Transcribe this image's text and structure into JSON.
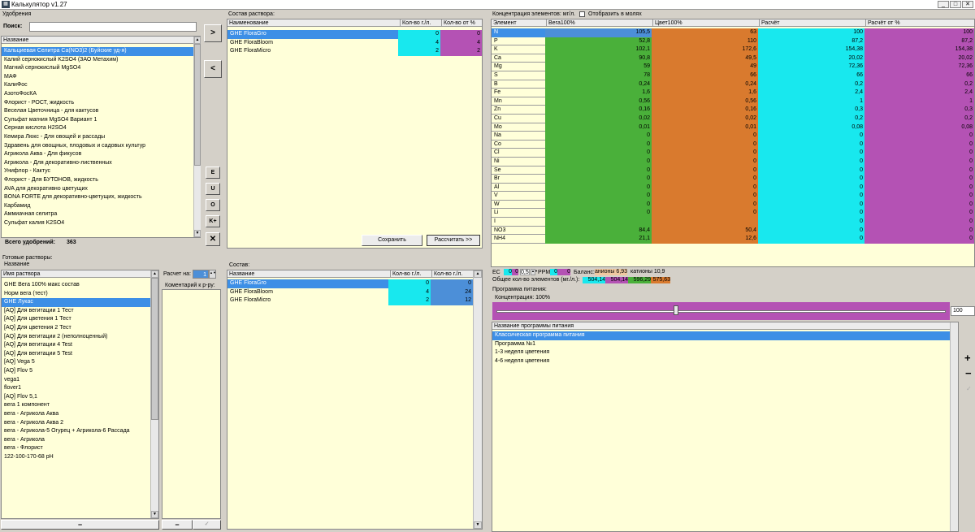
{
  "window": {
    "title": "Калькулятор v1.27",
    "icon": "calculator-icon"
  },
  "fert": {
    "group": "Удобрения",
    "search_label": "Поиск:",
    "search_value": "",
    "col_name": "Название",
    "items": [
      "Кальциевая Селитра Ca(NO3)2 (Буйские уд-я)",
      "Калий сернокислый K2SO4 (ЗАО Метахим)",
      "Магний сернокислый MgSO4",
      "МАФ",
      "КалиФос",
      "АзотоФосКА",
      "Флорист - РОСТ, жидкость",
      "Веселая Цветочница - для кактусов",
      "Сульфат магния MgSO4 Вариант 1",
      "Серная кислота H2SO4",
      "Кемира Люкс - Для овощей и рассады",
      "Здравень для овощных, плодовых и садовых культур",
      "Агрикола Аква - Для фикусов",
      "Агрикола - Для декоративно-лиственных",
      "Унифлор - Кактус",
      "Флорист - Для БУТОНОВ, жидкость",
      "AVA для декоративно цветущих",
      "BONA FORTE для декоративно-цветущих, жидкость",
      "Карбамид",
      "Аммиачная селитра",
      "Сульфат калия K2SO4"
    ],
    "total_label": "Всего удобрений:",
    "total_value": "363"
  },
  "side_buttons": [
    ">",
    "<",
    "E",
    "U",
    "O",
    "K+",
    "✕"
  ],
  "composition": {
    "group": "Состав раствора:",
    "cols": [
      "Наименование",
      "Кол-во г./л.",
      "Кол-во от %"
    ],
    "rows": [
      {
        "name": "GHE FloraGro",
        "g": "0",
        "p": "0"
      },
      {
        "name": "GHE FloraBloom",
        "g": "4",
        "p": "4"
      },
      {
        "name": "GHE FloraMicro",
        "g": "2",
        "p": "2"
      }
    ],
    "save_label": "Сохранить",
    "calc_label": "Рассчитать >>"
  },
  "conc": {
    "group": "Концентрация элементов: мг/л.",
    "show_moles": "Отобразить в молях",
    "cols": [
      "Элемент",
      "Вега100%",
      "Цвет100%",
      "Расчёт",
      "Расчёт от %"
    ],
    "rows": [
      {
        "el": "N",
        "v": "105,5",
        "c": "63",
        "r": "100",
        "rp": "100"
      },
      {
        "el": "P",
        "v": "52,8",
        "c": "110",
        "r": "87,2",
        "rp": "87,2"
      },
      {
        "el": "K",
        "v": "102,1",
        "c": "172,6",
        "r": "154,38",
        "rp": "154,38"
      },
      {
        "el": "Ca",
        "v": "90,8",
        "c": "49,5",
        "r": "20,02",
        "rp": "20,02"
      },
      {
        "el": "Mg",
        "v": "59",
        "c": "49",
        "r": "72,36",
        "rp": "72,36"
      },
      {
        "el": "S",
        "v": "78",
        "c": "66",
        "r": "66",
        "rp": "66"
      },
      {
        "el": "B",
        "v": "0,24",
        "c": "0,24",
        "r": "0,2",
        "rp": "0,2"
      },
      {
        "el": "Fe",
        "v": "1,6",
        "c": "1,6",
        "r": "2,4",
        "rp": "2,4"
      },
      {
        "el": "Mn",
        "v": "0,56",
        "c": "0,56",
        "r": "1",
        "rp": "1"
      },
      {
        "el": "Zn",
        "v": "0,16",
        "c": "0,16",
        "r": "0,3",
        "rp": "0,3"
      },
      {
        "el": "Cu",
        "v": "0,02",
        "c": "0,02",
        "r": "0,2",
        "rp": "0,2"
      },
      {
        "el": "Mo",
        "v": "0,01",
        "c": "0,01",
        "r": "0,08",
        "rp": "0,08"
      },
      {
        "el": "Na",
        "v": "0",
        "c": "0",
        "r": "0",
        "rp": "0"
      },
      {
        "el": "Co",
        "v": "0",
        "c": "0",
        "r": "0",
        "rp": "0"
      },
      {
        "el": "Cl",
        "v": "0",
        "c": "0",
        "r": "0",
        "rp": "0"
      },
      {
        "el": "Ni",
        "v": "0",
        "c": "0",
        "r": "0",
        "rp": "0"
      },
      {
        "el": "Se",
        "v": "0",
        "c": "0",
        "r": "0",
        "rp": "0"
      },
      {
        "el": "Br",
        "v": "0",
        "c": "0",
        "r": "0",
        "rp": "0"
      },
      {
        "el": "Al",
        "v": "0",
        "c": "0",
        "r": "0",
        "rp": "0"
      },
      {
        "el": "V",
        "v": "0",
        "c": "0",
        "r": "0",
        "rp": "0"
      },
      {
        "el": "W",
        "v": "0",
        "c": "0",
        "r": "0",
        "rp": "0"
      },
      {
        "el": "Li",
        "v": "0",
        "c": "0",
        "r": "0",
        "rp": "0"
      },
      {
        "el": "I",
        "v": "",
        "c": "",
        "r": "0",
        "rp": "0"
      },
      {
        "el": "NO3",
        "v": "84,4",
        "c": "50,4",
        "r": "0",
        "rp": "0"
      },
      {
        "el": "NH4",
        "v": "21,1",
        "c": "12,6",
        "r": "0",
        "rp": "0"
      }
    ]
  },
  "ec": {
    "ec_label": "EC",
    "ec_values": [
      "0",
      "0",
      "0,5"
    ],
    "ppm_label": "PPM",
    "ppm_values": [
      "0",
      "0"
    ],
    "balance_label": "Баланс:",
    "anions_label": "анионы",
    "anions_value": "6,93",
    "cations_label": "катионы",
    "cations_value": "10,9",
    "total_label": "Общее кол-во элементов (мг./л.):",
    "totals": [
      "504,14",
      "504,14",
      "596,29",
      "575,63"
    ]
  },
  "ready": {
    "group": "Готовые растворы:",
    "sub": "Название",
    "col": "Имя раствора",
    "items": [
      "GHE Вега 100% макс состав",
      "Норм вега (тест)",
      "GHE Лукас",
      "[AQ] Для вегитации 1 Тест",
      "[AQ] Для цветения 1 Тест",
      "[AQ] Для цветения 2 Тест",
      "[AQ] Для вегитации 2 (неполноценный)",
      "[AQ] Для вегитации 4 Test",
      "[AQ] Для вегитации 5 Test",
      "[AQ] Vega 5",
      "[AQ] Flov 5",
      "vega1",
      "flover1",
      "[AQ] Flov 5,1",
      "вега 1 компонент",
      "вега - Агрикола Аква",
      "вега - Агрикола Аква 2",
      "вега - Агрикола-5 Огурец + Агрикола-6 Рассада",
      "вега - Агрикола",
      "вега - Флорист",
      "122-100-170-68 pH"
    ],
    "minus": "−"
  },
  "calcon": {
    "label": "Расчет на:",
    "value": "1",
    "comment_label": "Коментарий к р-ру:",
    "minus": "−",
    "check": "✓"
  },
  "sostav": {
    "group": "Состав:",
    "cols": [
      "Название",
      "Кол-во г./л.",
      "Кол-во г./л."
    ],
    "rows": [
      {
        "name": "GHE FloraGro",
        "a": "0",
        "b": "0"
      },
      {
        "name": "GHE FloraBloom",
        "a": "4",
        "b": "24"
      },
      {
        "name": "GHE FloraMicro",
        "a": "2",
        "b": "12"
      }
    ]
  },
  "program": {
    "group": "Программа питания:",
    "conc_label": "Концентрация: 100%",
    "slider_value": "100",
    "slider_fraction": 0.4,
    "col": "Название программы питания",
    "items": [
      "Классическая программа питания",
      "Программа №1",
      "1-3 неделя цветения",
      "4-6 неделя цветения"
    ],
    "btns": [
      "+",
      "−",
      "✓"
    ]
  },
  "colors": {
    "cyan": "#18e8ee",
    "magenta": "#b452b4",
    "green": "#4ab03a",
    "orange": "#d97a2e",
    "select": "#3d8fe6",
    "panel": "#ffffd9"
  }
}
